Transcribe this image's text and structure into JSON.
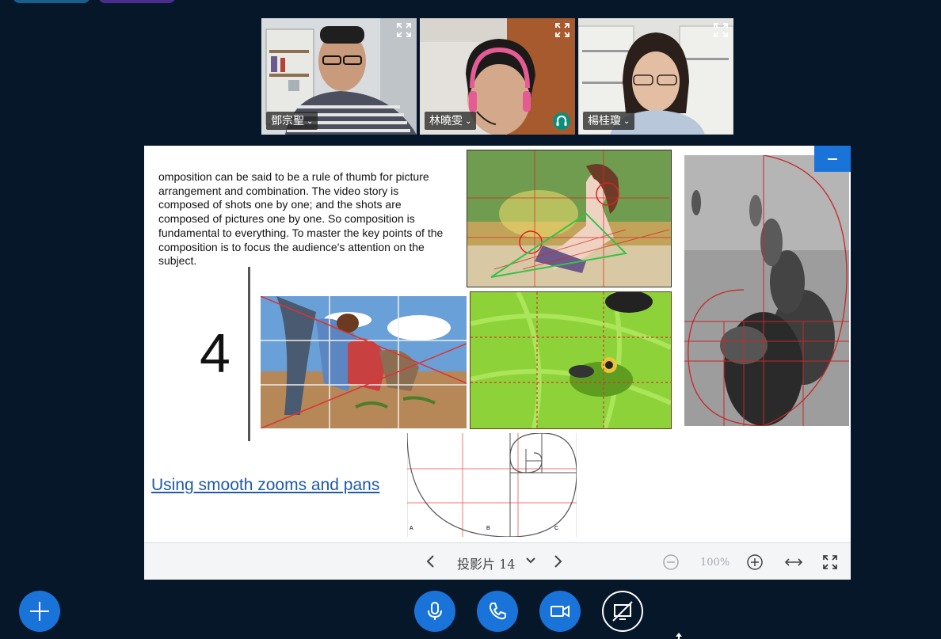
{
  "participants": [
    {
      "name": "鄧宗聖",
      "active": false,
      "headset": false
    },
    {
      "name": "林曉雯",
      "active": false,
      "headset": true
    },
    {
      "name": "楊桂瓊",
      "active": true,
      "headset": false
    }
  ],
  "slide": {
    "text": "omposition can be said to be a rule of thumb for picture arrangement and combination. The video story is composed of shots one by one; and the shots are composed of pictures one by one. So composition is fundamental to everything. To master the key points of the composition is to focus the audience's attention on the subject.",
    "number": "4",
    "link": "Using smooth zooms and pans",
    "diagram_labels": [
      "A",
      "B",
      "C"
    ]
  },
  "toolbar": {
    "slide_label": "投影片 14",
    "zoom": "100%"
  },
  "icons": {
    "expand": "expand-icon",
    "prev": "chevron-left-icon",
    "next": "chevron-right-icon",
    "menu": "chevron-down-icon",
    "zoom_out": "zoom-out-icon",
    "zoom_in": "zoom-in-icon",
    "fit_width": "fit-width-icon",
    "fullscreen": "fullscreen-icon",
    "mic": "microphone-icon",
    "phone": "phone-icon",
    "video": "video-camera-icon",
    "share": "screen-share-off-icon",
    "add": "plus-icon",
    "headset": "headset-icon"
  },
  "colors": {
    "background": "#06172a",
    "accent": "#1a73d9",
    "active_border": "#2f8df0",
    "link": "#1f5aa8"
  }
}
